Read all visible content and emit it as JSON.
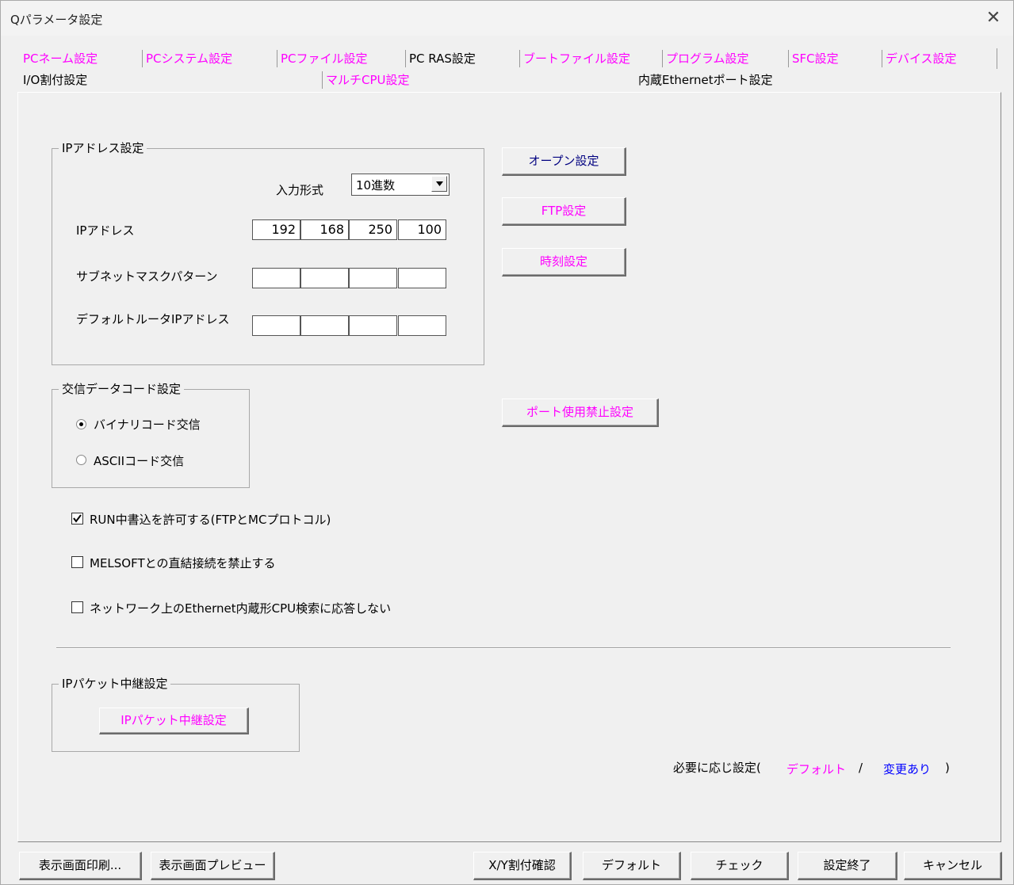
{
  "window": {
    "title": "Qパラメータ設定",
    "close_symbol": "✕"
  },
  "tabs_row1": [
    "PCネーム設定",
    "PCシステム設定",
    "PCファイル設定",
    "PC RAS設定",
    "ブートファイル設定",
    "プログラム設定",
    "SFC設定",
    "デバイス設定"
  ],
  "tabs_row2": [
    "I/O割付設定",
    "マルチCPU設定",
    "内蔵Ethernetポート設定"
  ],
  "ip_group": {
    "title": "IPアドレス設定",
    "input_format_label": "入力形式",
    "input_format_value": "10進数",
    "ip_label": "IPアドレス",
    "ip_values": [
      "192",
      "168",
      "250",
      "100"
    ],
    "subnet_label": "サブネットマスクパターン",
    "subnet_values": [
      "",
      "",
      "",
      ""
    ],
    "gateway_label": "デフォルトルータIPアドレス",
    "gateway_values": [
      "",
      "",
      "",
      ""
    ]
  },
  "side_buttons": {
    "open": "オープン設定",
    "ftp": "FTP設定",
    "time": "時刻設定",
    "port_block": "ポート使用禁止設定"
  },
  "comm_group": {
    "title": "交信データコード設定",
    "binary": "バイナリコード交信",
    "ascii": "ASCIIコード交信",
    "selected": "binary"
  },
  "checks": {
    "run_write": {
      "label": "RUN中書込を許可する(FTPとMCプロトコル)",
      "checked": true
    },
    "melsoft": {
      "label": "MELSOFTとの直結接続を禁止する",
      "checked": false
    },
    "no_search": {
      "label": "ネットワーク上のEthernet内蔵形CPU検索に応答しない",
      "checked": false
    }
  },
  "relay_group": {
    "title": "IPパケット中継設定",
    "button": "IPパケット中継設定"
  },
  "legend": {
    "prefix": "必要に応じ設定(",
    "default": "デフォルト",
    "slash": "/",
    "changed": "変更あり",
    "suffix": ")"
  },
  "footer": {
    "print": "表示画面印刷...",
    "preview": "表示画面プレビュー",
    "xy_check": "X/Y割付確認",
    "default": "デフォルト",
    "check": "チェック",
    "finish": "設定終了",
    "cancel": "キャンセル"
  },
  "colors": {
    "accent": "#ff00ff",
    "changed": "#0000ff",
    "set_button": "#000080"
  }
}
